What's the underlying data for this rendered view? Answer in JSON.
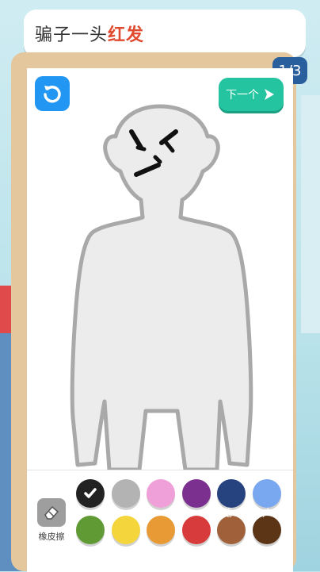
{
  "prompt": {
    "prefix": "骗子一头",
    "highlight": "红发"
  },
  "page_indicator": "1/3",
  "buttons": {
    "reset_icon": "undo-icon",
    "next_label": "下一个"
  },
  "eraser": {
    "label": "橡皮擦",
    "icon": "eraser-icon"
  },
  "colors": [
    {
      "name": "black",
      "hex": "#222222",
      "selected": true
    },
    {
      "name": "gray",
      "hex": "#b3b3b3"
    },
    {
      "name": "pink",
      "hex": "#f0a0d8"
    },
    {
      "name": "purple",
      "hex": "#7b2f8e"
    },
    {
      "name": "navy",
      "hex": "#26427f"
    },
    {
      "name": "light-blue",
      "hex": "#7aa8f0"
    },
    {
      "name": "green",
      "hex": "#5f9a34"
    },
    {
      "name": "yellow",
      "hex": "#f4d53c"
    },
    {
      "name": "orange",
      "hex": "#e89a35"
    },
    {
      "name": "red",
      "hex": "#d83b3b"
    },
    {
      "name": "brown",
      "hex": "#a0613a"
    },
    {
      "name": "dark-brown",
      "hex": "#5c3416"
    }
  ],
  "watermark": "花 小 草 广"
}
